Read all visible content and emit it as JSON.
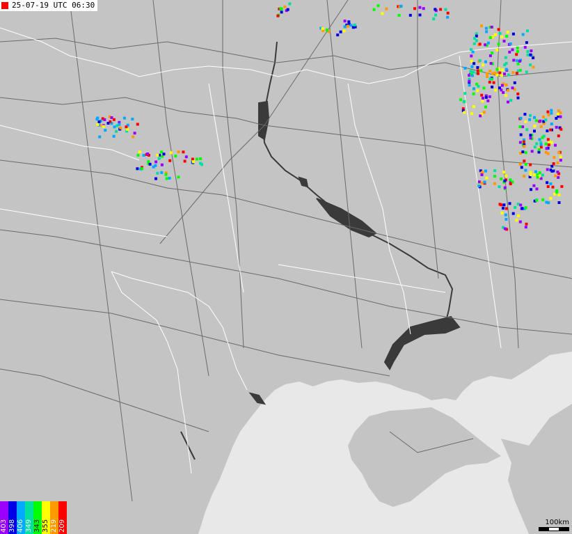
{
  "timestamp": "25-07-19 UTC 06:30",
  "scale_label": "100km",
  "legend": [
    {
      "label": "403",
      "color": "#9b00ff"
    },
    {
      "label": "398",
      "color": "#0000e6"
    },
    {
      "label": "406",
      "color": "#00aaff"
    },
    {
      "label": "349",
      "color": "#00e0a0"
    },
    {
      "label": "343",
      "color": "#00ff00"
    },
    {
      "label": "355",
      "color": "#ffff00"
    },
    {
      "label": "219",
      "color": "#ff9900"
    },
    {
      "label": "209",
      "color": "#ff0000"
    }
  ],
  "colors": {
    "land": "#c4c4c4",
    "sea": "#e8e8e8",
    "water_bodies": "#3a3a3a",
    "roads": "#6a6a6a",
    "borders": "#ffffff"
  }
}
